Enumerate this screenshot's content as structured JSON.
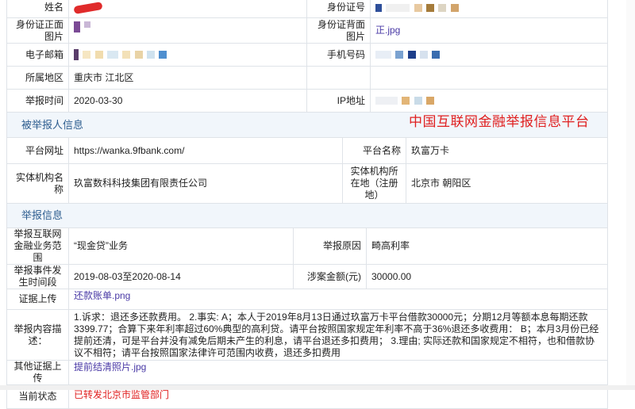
{
  "reporter": {
    "name_label": "姓名",
    "id_label": "身份证号",
    "id_front_label": "身份证正面图片",
    "id_back_label": "身份证背面图片",
    "id_back_file": "正.jpg",
    "email_label": "电子邮箱",
    "phone_label": "手机号码",
    "region_label": "所属地区",
    "region_value": "重庆市 江北区",
    "report_time_label": "举报时间",
    "report_time_value": "2020-03-30",
    "ip_label": "IP地址"
  },
  "reported_section": {
    "title": "被举报人信息",
    "platform_url_label": "平台网址",
    "platform_url_value": "https://wanka.9fbank.com/",
    "platform_name_label": "平台名称",
    "platform_name_value": "玖富万卡",
    "entity_label": "实体机构名称",
    "entity_value": "玖富数科科技集团有限责任公司",
    "entity_loc_label": "实体机构所在地（注册地）",
    "entity_loc_value": "北京市 朝阳区"
  },
  "report_section": {
    "title": "举报信息",
    "scope_label": "举报互联网金融业务范围",
    "scope_value": "“现金贷”业务",
    "reason_label": "举报原因",
    "reason_value": "畸高利率",
    "period_label": "举报事件发生时间段",
    "period_value": "2019-08-03至2020-08-14",
    "amount_label": "涉案金额(元)",
    "amount_value": "30000.00",
    "evidence_label": "证据上传",
    "evidence_file": "还款账单.png",
    "content_label": "举报内容描述：",
    "content_value": "1.诉求：退还多还款费用。 2.事实: A；本人于2019年8月13日通过玖富万卡平台借款30000元；分期12月等额本息每期还款3399.77；合算下来年利率超过60%典型的高利贷。请平台按照国家规定年利率不高于36%退还多收费用： B；本月3月份已经提前还清，可是平台并没有减免后期未产生的利息，请平台退还多扣费用； 3.理由; 实际还款和国家规定不相符，也和借款协议不相符；请平台按照国家法律许可范围内收费，退还多扣费用",
    "other_evidence_label": "其他证据上传",
    "other_evidence_file": "提前结清照片.jpg",
    "status_label": "当前状态",
    "status_value": "已转发北京市监管部门"
  },
  "watermark": "中国互联网金融举报信息平台",
  "colors": {
    "section_bg": "#f1f6fb",
    "section_text": "#2d5d8f",
    "link": "#4a3aa6",
    "status": "#e02020",
    "border": "#dfe3e8"
  }
}
